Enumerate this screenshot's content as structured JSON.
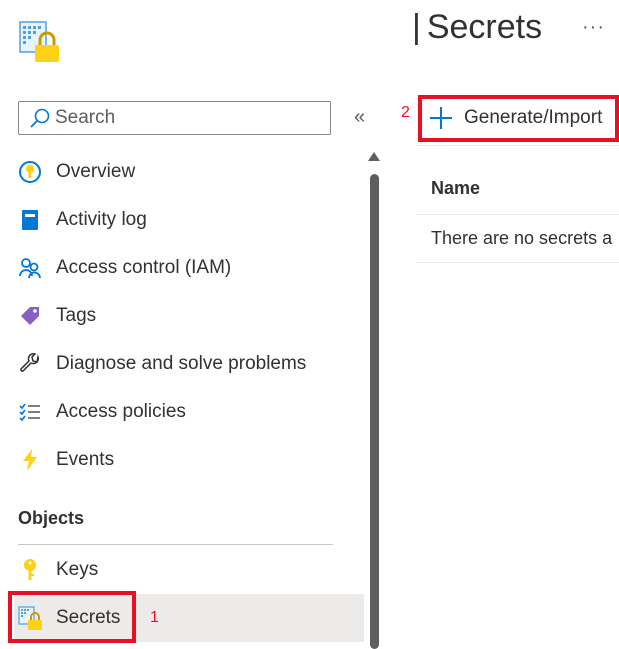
{
  "header": {
    "title": "Secrets",
    "more_label": "···"
  },
  "sidebar": {
    "search": {
      "placeholder": "Search",
      "value": ""
    },
    "collapse_label": "«",
    "items": [
      {
        "label": "Overview",
        "icon": "overview-icon"
      },
      {
        "label": "Activity log",
        "icon": "activity-log-icon"
      },
      {
        "label": "Access control (IAM)",
        "icon": "access-control-icon"
      },
      {
        "label": "Tags",
        "icon": "tag-icon"
      },
      {
        "label": "Diagnose and solve problems",
        "icon": "wrench-icon"
      },
      {
        "label": "Access policies",
        "icon": "checklist-icon"
      },
      {
        "label": "Events",
        "icon": "lightning-icon"
      }
    ],
    "section": {
      "title": "Objects",
      "items": [
        {
          "label": "Keys",
          "icon": "key-icon",
          "selected": false
        },
        {
          "label": "Secrets",
          "icon": "secret-icon",
          "selected": true
        }
      ]
    }
  },
  "toolbar": {
    "generate_import_label": "Generate/Import"
  },
  "table": {
    "columns": [
      "Name"
    ],
    "empty_message": "There are no secrets a"
  },
  "annotations": {
    "step1": "1",
    "step2": "2",
    "color": "#e81123"
  },
  "colors": {
    "accent": "#0078d4",
    "selected_bg": "#edebe9",
    "key_yellow": "#fcd116"
  }
}
